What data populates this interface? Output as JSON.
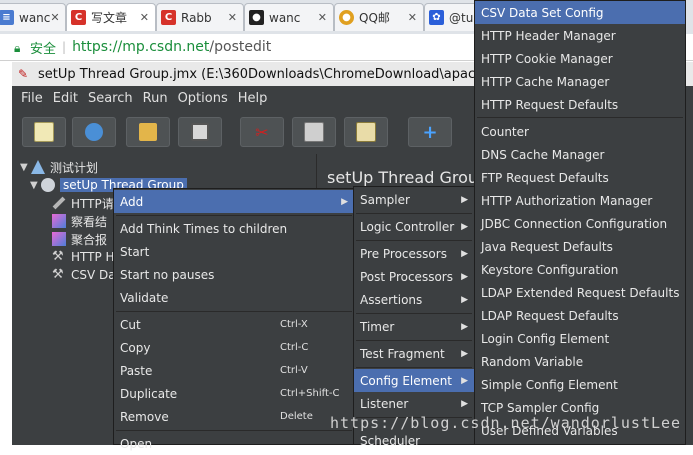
{
  "browser": {
    "tabs": [
      {
        "label": "wanc",
        "icon": "doc-icon",
        "color": "#4a7bd0"
      },
      {
        "label": "写文章",
        "icon": "csdn-icon",
        "color": "#d6322a"
      },
      {
        "label": "Rabb",
        "icon": "csdn-icon",
        "color": "#d6322a"
      },
      {
        "label": "wanc",
        "icon": "github-icon",
        "color": "#222222"
      },
      {
        "label": "QQ邮",
        "icon": "chrome-icon",
        "color": "#e0a020"
      },
      {
        "label": "@tu",
        "icon": "baidu-paw-icon",
        "color": "#2b5fd9"
      }
    ],
    "secure_label": "安全",
    "url_host": "https://mp.csdn.net",
    "url_path": "/postedit"
  },
  "jmeter": {
    "title": "setUp Thread Group.jmx (E:\\360Downloads\\ChromeDownload\\apache-jmet",
    "menu": [
      "File",
      "Edit",
      "Search",
      "Run",
      "Options",
      "Help"
    ],
    "tree": {
      "root": "测试计划",
      "selected": "setUp Thread Group",
      "children": [
        "HTTP请",
        "察看结",
        "聚合报",
        "HTTP H",
        "CSV Da"
      ]
    },
    "panel_title": "setUp Thread Grou"
  },
  "context_menu": {
    "add": "Add",
    "think_times": "Add Think Times to children",
    "start": "Start",
    "start_no_pauses": "Start no pauses",
    "validate": "Validate",
    "cut": {
      "label": "Cut",
      "shortcut": "Ctrl-X"
    },
    "copy": {
      "label": "Copy",
      "shortcut": "Ctrl-C"
    },
    "paste": {
      "label": "Paste",
      "shortcut": "Ctrl-V"
    },
    "duplicate": {
      "label": "Duplicate",
      "shortcut": "Ctrl+Shift-C"
    },
    "remove": {
      "label": "Remove",
      "shortcut": "Delete"
    },
    "open": "Open"
  },
  "add_submenu": [
    "Sampler",
    "Logic Controller",
    "Pre Processors",
    "Post Processors",
    "Assertions",
    "Timer",
    "Test Fragment",
    "Config Element",
    "Listener",
    "Scheduler"
  ],
  "config_submenu": {
    "group1": [
      "CSV Data Set Config",
      "HTTP Header Manager",
      "HTTP Cookie Manager",
      "HTTP Cache Manager",
      "HTTP Request Defaults"
    ],
    "group2": [
      "Counter",
      "DNS Cache Manager",
      "FTP Request Defaults",
      "HTTP Authorization Manager",
      "JDBC Connection Configuration",
      "Java Request Defaults",
      "Keystore Configuration",
      "LDAP Extended Request Defaults",
      "LDAP Request Defaults",
      "Login Config Element",
      "Random Variable",
      "Simple Config Element",
      "TCP Sampler Config",
      "User Defined Variables"
    ]
  },
  "watermark": "https://blog.csdn.net/wandorlustLee"
}
